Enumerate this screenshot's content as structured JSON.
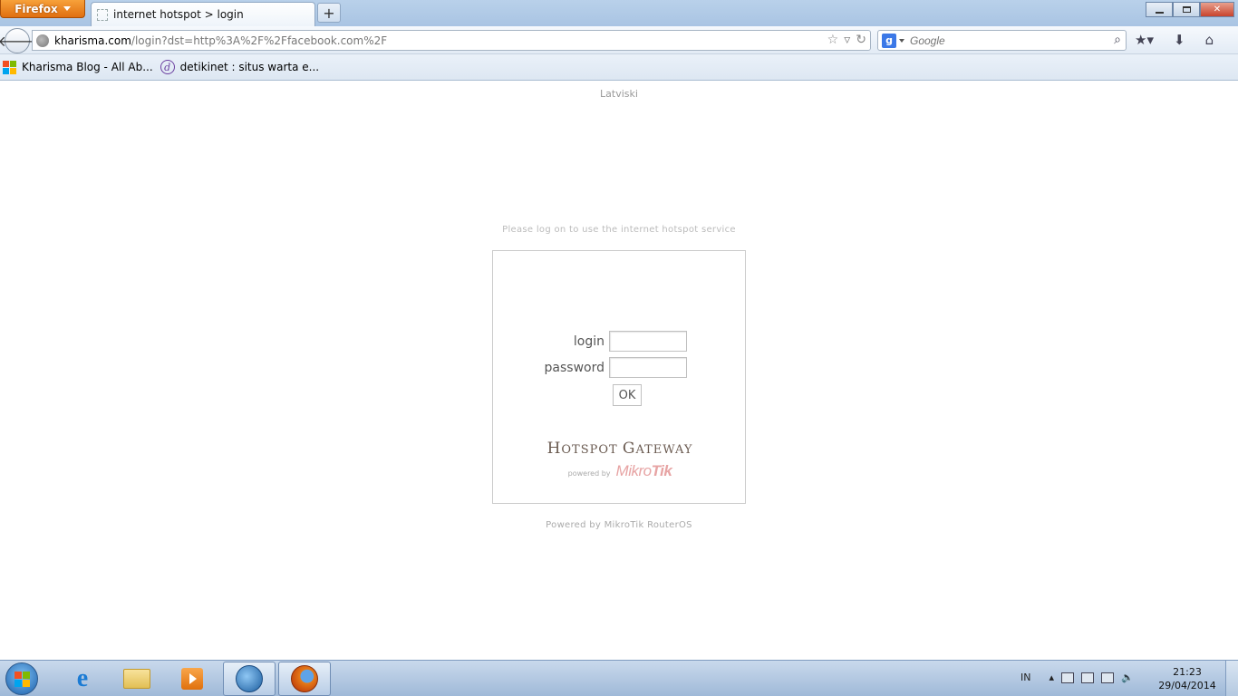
{
  "browser": {
    "menu_label": "Firefox",
    "tab_title": "internet hotspot > login",
    "new_tab_symbol": "+",
    "url_domain": "kharisma.com",
    "url_path": "/login?dst=http%3A%2F%2Ffacebook.com%2F",
    "search_placeholder": "Google",
    "search_engine_icon": "g",
    "bookmarks": [
      {
        "label": "Kharisma Blog - All Ab...",
        "icon": "windows-icon"
      },
      {
        "label": "detikinet : situs warta e...",
        "icon": "detik-icon"
      }
    ]
  },
  "page": {
    "language_link": "Latviski",
    "hint": "Please log on to use the internet hotspot service",
    "login_label": "login",
    "password_label": "password",
    "login_value": "",
    "password_value": "",
    "ok_label": "OK",
    "brand_first": "H",
    "brand_rest_1": "OTSPOT ",
    "brand_rest_2": "GATEWAY",
    "powered_small": "powered by",
    "mikrotik_a": "Mikro",
    "mikrotik_b": "Tik",
    "footer": "Powered by MikroTik RouterOS"
  },
  "taskbar": {
    "language": "IN",
    "time": "21:23",
    "date": "29/04/2014",
    "pinned": [
      "internet-explorer-icon",
      "file-explorer-icon",
      "media-player-icon",
      "app-icon",
      "firefox-icon"
    ]
  },
  "colors": {
    "firefox_orange": "#e06f10",
    "mikrotik_pink": "#e7a4a4",
    "border_gray": "#cccccc"
  }
}
